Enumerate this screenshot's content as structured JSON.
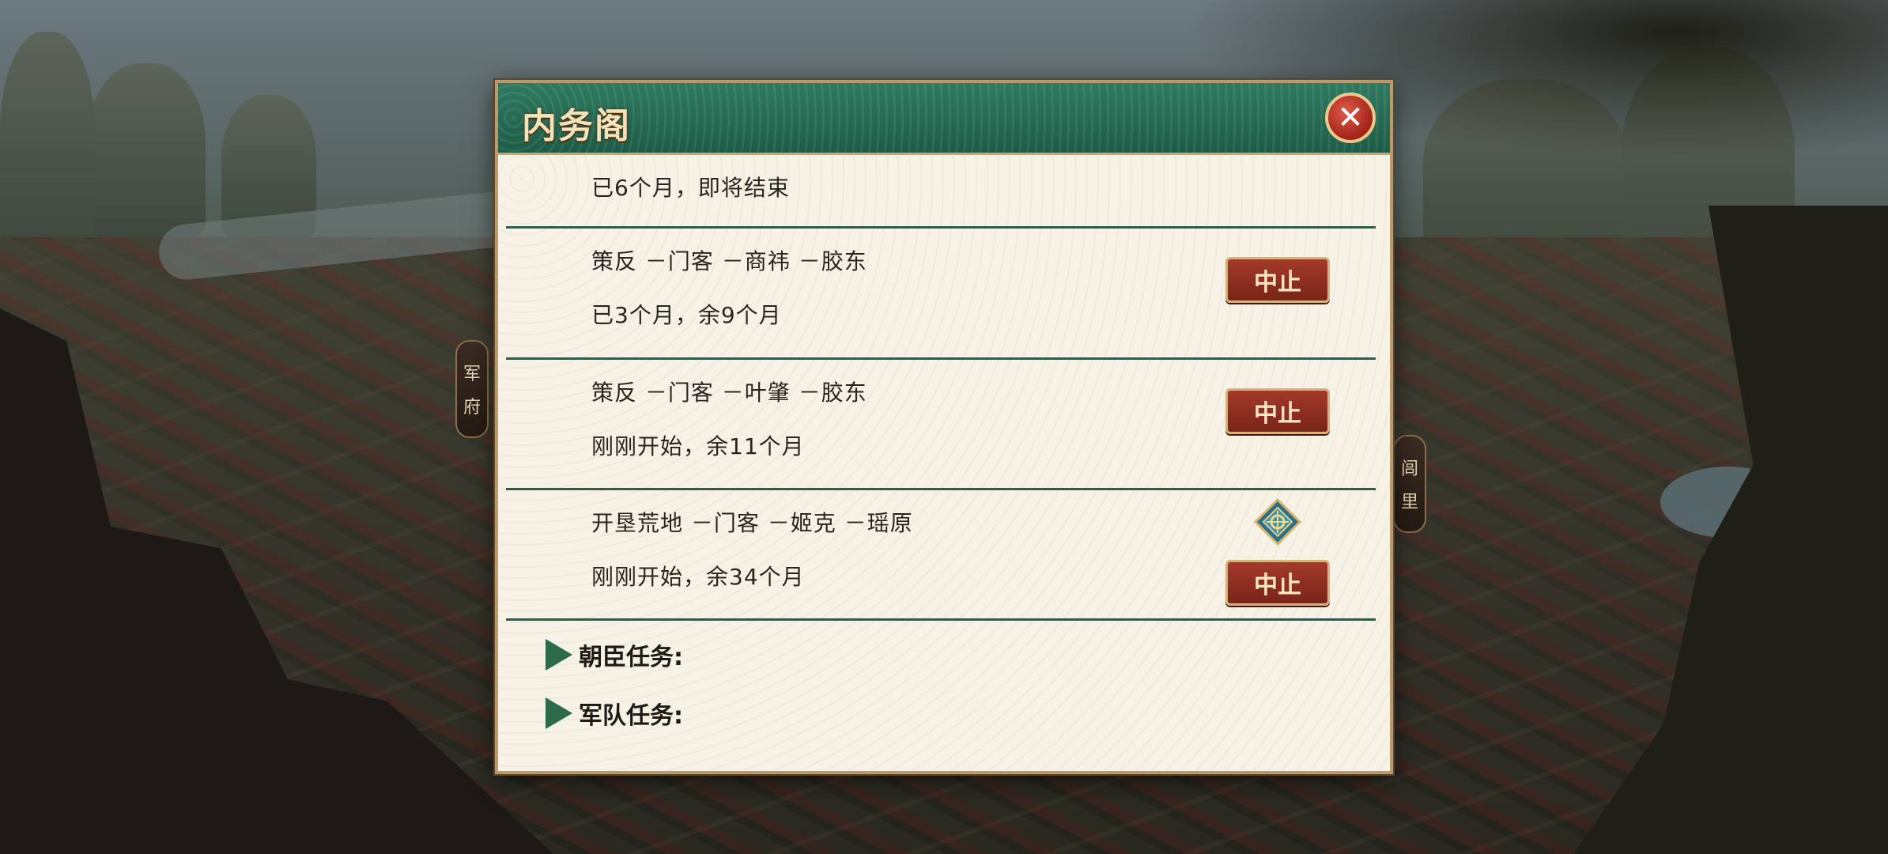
{
  "side_tabs": {
    "left": [
      "军",
      "府"
    ],
    "right": [
      "闾",
      "里"
    ]
  },
  "dialog": {
    "title": "内务阁",
    "close_icon": "close-icon"
  },
  "tasks": [
    {
      "line1": "",
      "line2": "已6个月，即将结束",
      "button": ""
    },
    {
      "line1": "策反 －门客 －商祎 －胶东",
      "line2": "已3个月，余9个月",
      "button": "中止"
    },
    {
      "line1": "策反 －门客 －叶肇 －胶东",
      "line2": "刚刚开始，余11个月",
      "button": "中止"
    },
    {
      "line1": "开垦荒地 －门客 －姬克 －瑶原",
      "line2": "刚刚开始，余34个月",
      "button": "中止",
      "badge_icon": "settle-badge-icon"
    }
  ],
  "sections": {
    "minister": "朝臣任务:",
    "army": "军队任务:"
  },
  "colors": {
    "header": "#1d5c48",
    "accent_gold": "#c8a76e",
    "stop_button": "#8a2a1c"
  }
}
